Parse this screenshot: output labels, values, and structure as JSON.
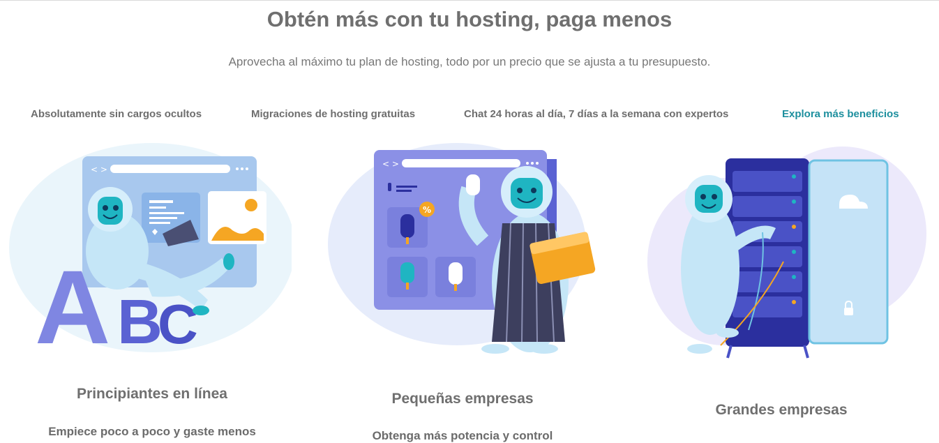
{
  "hero": {
    "title": "Obtén más con tu hosting, paga menos",
    "subtitle": "Aprovecha al máximo tu plan de hosting, todo por un precio que se ajusta a tu presupuesto."
  },
  "benefits": {
    "items": [
      "Absolutamente sin cargos ocultos",
      "Migraciones de hosting gratuitas",
      "Chat 24 horas al día, 7 días a la semana con expertos"
    ],
    "explore_link": "Explora más beneficios"
  },
  "cards": [
    {
      "title": "Principiantes en línea",
      "description": "Empiece poco a poco y gaste menos",
      "illustration": "yeti-laptop-abc-illustration"
    },
    {
      "title": "Pequeñas empresas",
      "description": "Obtenga más potencia y control",
      "illustration": "yeti-shop-popsicles-illustration"
    },
    {
      "title": "Grandes empresas",
      "description": "",
      "illustration": "yeti-server-rack-illustration"
    }
  ],
  "colors": {
    "accent_link": "#1d8f9e",
    "yeti_face": "#1fb5c2",
    "periwinkle": "#8b90e6",
    "navy": "#2b2f9e",
    "orange": "#f5a623"
  }
}
